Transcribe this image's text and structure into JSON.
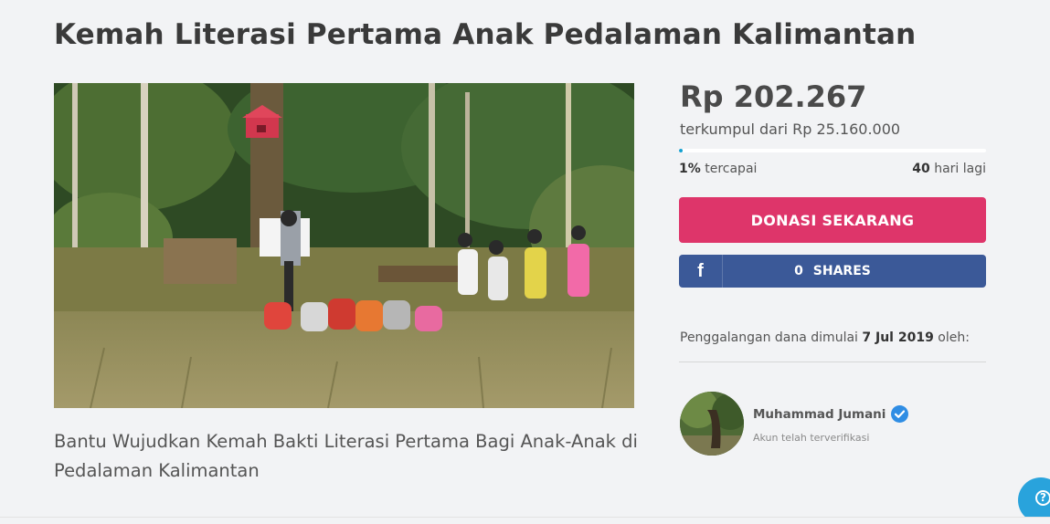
{
  "campaign": {
    "title": "Kemah Literasi Pertama Anak Pedalaman Kalimantan",
    "description": "Bantu Wujudkan Kemah Bakti Literasi Pertama Bagi Anak-Anak di Pedalaman Kalimantan",
    "image_alt": "forest-camp-photo"
  },
  "funding": {
    "collected": "Rp 202.267",
    "target_text": "terkumpul dari Rp 25.160.000",
    "progress_percent": 1,
    "percent_label": "1%",
    "percent_suffix": "tercapai",
    "days_left": "40",
    "days_suffix": "hari lagi"
  },
  "actions": {
    "donate_label": "DONASI SEKARANG",
    "share_icon": "f",
    "share_count": "0",
    "share_label": "SHARES"
  },
  "organizer": {
    "started_prefix": "Penggalangan dana dimulai",
    "started_date": "7 Jul 2019",
    "started_suffix": "oleh:",
    "name": "Muhammad Jumani",
    "status": "Akun telah terverifikasi"
  },
  "help": {
    "icon": "?"
  },
  "colors": {
    "donate": "#de356a",
    "facebook": "#3b5998",
    "progress": "#13a0d0",
    "verified": "#2f8de4",
    "help": "#29a3dc"
  }
}
